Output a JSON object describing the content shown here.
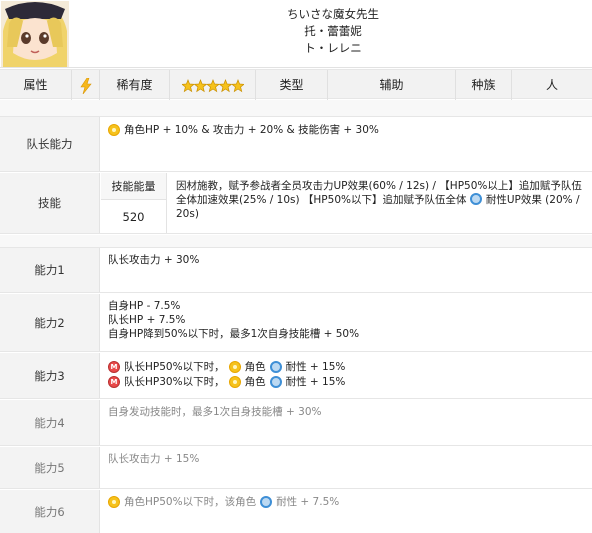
{
  "header": {
    "name_jp": "ちいさな魔女先生",
    "name_cn": "托・蕾蕾妮",
    "name_kana": "ト・レレニ"
  },
  "attributes": {
    "attr_label": "属性",
    "rarity_label": "稀有度",
    "rarity_stars": 5,
    "type_label": "类型",
    "type_value": "辅助",
    "race_label": "种族",
    "race_value": "人",
    "accent_color": "#f6c21c"
  },
  "leader": {
    "label": "队长能力",
    "text": "角色HP + 10% & 攻击力 + 20% & 技能伤害 + 30%"
  },
  "skill": {
    "label": "技能",
    "energy_label": "技能能量",
    "energy_value": "520",
    "desc_a": "因材施教，赋予参战者全员攻击力UP效果(60% / 12s) / 【HP50%以上】追加赋予队伍全体加速效果(25% / 10s) 【HP50%以下】追加赋予队伍全体",
    "desc_b": "耐性UP效果 (20% / 20s)"
  },
  "abilities": [
    {
      "label": "能力1",
      "lines": [
        "队长攻击力 + 30%"
      ]
    },
    {
      "label": "能力2",
      "lines": [
        "自身HP - 7.5%",
        "队长HP + 7.5%",
        "自身HP降到50%以下时，最多1次自身技能槽 + 50%"
      ]
    },
    {
      "label": "能力3",
      "line1_a": "队长HP50%以下时，",
      "line1_b": "角色",
      "line1_c": "耐性 + 15%",
      "line2_a": "队长HP30%以下时，",
      "line2_b": "角色",
      "line2_c": "耐性 + 15%"
    },
    {
      "label": "能力4",
      "lines": [
        "自身发动技能时，最多1次自身技能槽 + 30%"
      ]
    },
    {
      "label": "能力5",
      "lines": [
        "队长攻击力 + 15%"
      ]
    },
    {
      "label": "能力6",
      "line_a": "角色HP50%以下时，该角色",
      "line_b": "耐性 + 7.5%"
    }
  ]
}
